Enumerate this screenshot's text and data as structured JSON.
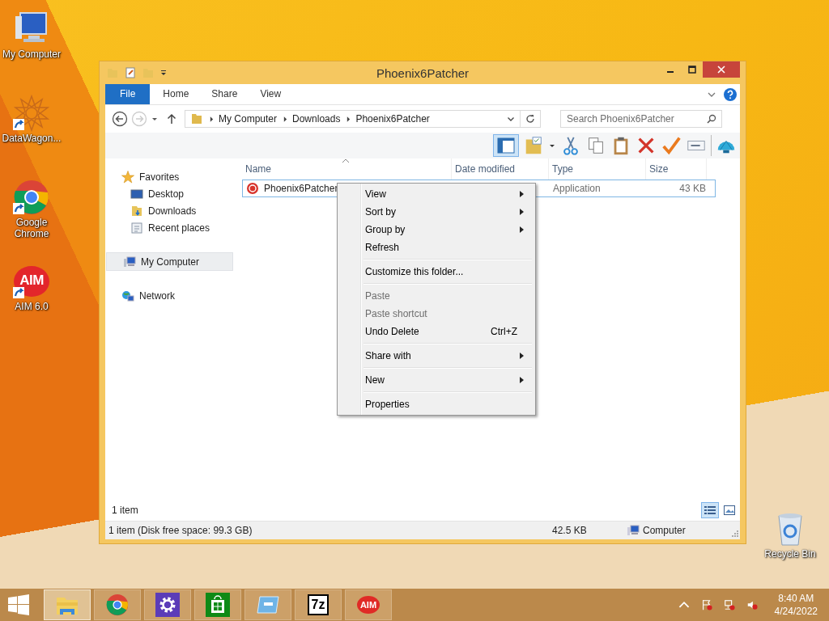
{
  "desktop_icons": [
    {
      "label": "My Computer",
      "kind": "computer",
      "shortcut": false
    },
    {
      "label": "DataWagon...",
      "kind": "star",
      "shortcut": true
    },
    {
      "label": "Google Chrome",
      "kind": "chrome",
      "shortcut": true
    },
    {
      "label": "AIM 6.0",
      "kind": "aim",
      "glyph": "AIM",
      "shortcut": true
    }
  ],
  "recycle_bin": {
    "label": "Recycle Bin"
  },
  "window": {
    "title": "Phoenix6Patcher",
    "ribbon_tabs": [
      {
        "label": "File",
        "kind": "file"
      },
      {
        "label": "Home",
        "kind": "tab"
      },
      {
        "label": "Share",
        "kind": "tab"
      },
      {
        "label": "View",
        "kind": "tab"
      }
    ],
    "breadcrumbs": [
      "My Computer",
      "Downloads",
      "Phoenix6Patcher"
    ],
    "search": {
      "placeholder": "Search Phoenix6Patcher"
    },
    "sidebar": [
      {
        "label": "Favorites",
        "kind": "favorites",
        "selected": false,
        "children": [
          {
            "label": "Desktop",
            "kind": "desktop",
            "selected": false
          },
          {
            "label": "Downloads",
            "kind": "downloads",
            "selected": false
          },
          {
            "label": "Recent places",
            "kind": "recent",
            "selected": false
          }
        ]
      },
      {
        "label": "My Computer",
        "kind": "computer",
        "selected": true
      },
      {
        "label": "Network",
        "kind": "network",
        "selected": false
      }
    ],
    "columns": [
      "Name",
      "Date modified",
      "Type",
      "Size"
    ],
    "rows": [
      {
        "name": "Phoenix6Patcher",
        "type": "Application",
        "size": "43 KB",
        "selected": true
      }
    ],
    "item_count": "1 item",
    "views": [
      {
        "kind": "details",
        "selected": true
      },
      {
        "kind": "large",
        "selected": false
      }
    ],
    "status_bar": {
      "summary": "1 item (Disk free space: 99.3 GB)",
      "size": "42.5 KB",
      "location": "Computer"
    }
  },
  "context_menu": [
    [
      {
        "label": "View",
        "submenu": true,
        "disabled": false
      },
      {
        "label": "Sort by",
        "submenu": true,
        "disabled": false
      },
      {
        "label": "Group by",
        "submenu": true,
        "disabled": false
      },
      {
        "label": "Refresh",
        "submenu": false,
        "disabled": false
      }
    ],
    [
      {
        "label": "Customize this folder...",
        "submenu": false,
        "disabled": false
      }
    ],
    [
      {
        "label": "Paste",
        "submenu": false,
        "disabled": true
      },
      {
        "label": "Paste shortcut",
        "submenu": false,
        "disabled": true
      },
      {
        "label": "Undo Delete",
        "shortcut": "Ctrl+Z",
        "submenu": false,
        "disabled": false
      }
    ],
    [
      {
        "label": "Share with",
        "submenu": true,
        "disabled": false
      }
    ],
    [
      {
        "label": "New",
        "submenu": true,
        "disabled": false
      }
    ],
    [
      {
        "label": "Properties",
        "submenu": false,
        "disabled": false
      }
    ]
  ],
  "taskbar": {
    "items": [
      {
        "kind": "explorer",
        "selected": true
      },
      {
        "kind": "chrome",
        "selected": false
      },
      {
        "kind": "settings",
        "selected": false
      },
      {
        "kind": "store",
        "selected": false
      },
      {
        "kind": "screen",
        "selected": false
      },
      {
        "kind": "sevenzip",
        "glyph": "7z",
        "selected": false
      },
      {
        "kind": "aim",
        "glyph": "AIM",
        "selected": false
      }
    ],
    "time": "8:40 AM",
    "date": "4/24/2022"
  }
}
